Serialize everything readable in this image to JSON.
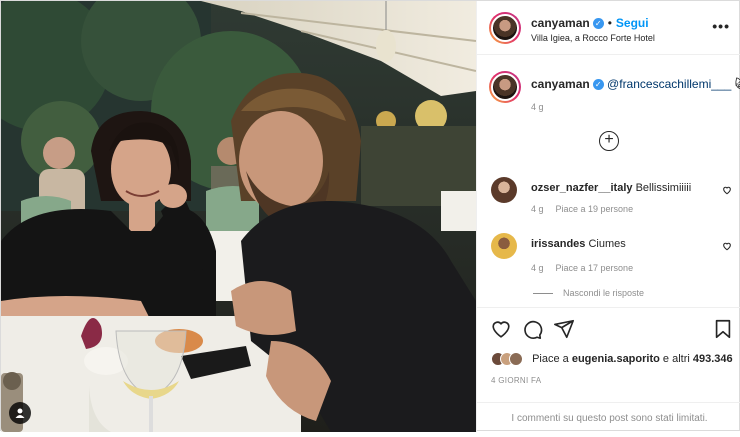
{
  "header": {
    "username": "canyaman",
    "follow_label": "Segui",
    "location": "Villa Igiea, a Rocco Forte Hotel",
    "more_label": "•••"
  },
  "caption": {
    "username": "canyaman",
    "mention": "@francescachillemi___",
    "emoji": "🙀",
    "time": "4 g",
    "load_more_label": "+"
  },
  "comments": [
    {
      "username": "ozser_nazfer__italy",
      "text": "Bellissimiiiii",
      "time": "4 g",
      "likes": "Piace a 19 persone"
    },
    {
      "username": "irissandes",
      "text": "Ciumes",
      "time": "4 g",
      "likes": "Piace a 17 persone"
    }
  ],
  "hidden_replies_label": "Nascondi le risposte",
  "likes": {
    "prefix": "Piace a",
    "user": "eugenia.saporito",
    "connector": "e altri",
    "count": "493.346"
  },
  "date": "4 GIORNI FA",
  "comments_limited": "I commenti su questo post sono stati limitati.",
  "colors": {
    "accent": "#0095f6",
    "verified": "#3897f0",
    "muted": "#8e8e8e"
  }
}
